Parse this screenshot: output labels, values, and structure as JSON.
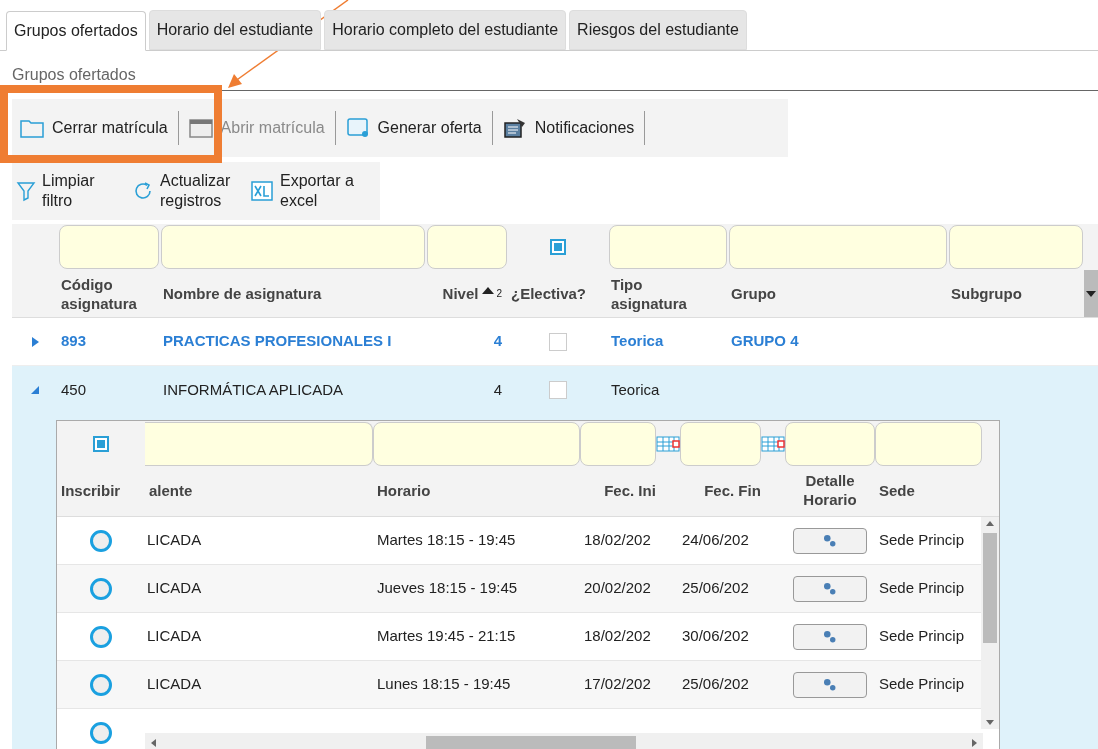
{
  "tabs": [
    {
      "label": "Grupos ofertados",
      "selected": true
    },
    {
      "label": "Horario del estudiante",
      "selected": false
    },
    {
      "label": "Horario completo del estudiante",
      "selected": false
    },
    {
      "label": "Riesgos del estudiante",
      "selected": false
    }
  ],
  "section_title": "Grupos ofertados",
  "toolbar": [
    {
      "kind": "folder",
      "label": "Cerrar matrícula",
      "disabled": false
    },
    {
      "kind": "window",
      "label": "Abrir matrícula",
      "disabled": true
    },
    {
      "kind": "drive",
      "label": "Generar oferta",
      "disabled": false
    },
    {
      "kind": "notify",
      "label": "Notificaciones",
      "disabled": false
    }
  ],
  "actions": [
    {
      "kind": "filter",
      "label": "Limpiar filtro"
    },
    {
      "kind": "refresh",
      "label": "Actualizar registros"
    },
    {
      "kind": "excel",
      "label": "Exportar a excel"
    }
  ],
  "grid": {
    "electiva_filter_indeterminate": true,
    "columns": [
      {
        "label": "Código asignatura"
      },
      {
        "label": "Nombre de asignatura"
      },
      {
        "label": "Nivel",
        "sort": "2"
      },
      {
        "label": "¿Electiva?"
      },
      {
        "label": "Tipo asignatura"
      },
      {
        "label": "Grupo"
      },
      {
        "label": "Subgrupo"
      }
    ],
    "rows": [
      {
        "codigo": "893",
        "nombre": "PRACTICAS PROFESIONALES I",
        "nivel": "4",
        "electiva": false,
        "tipo": "Teorica",
        "grupo": "GRUPO 4",
        "expanded": false,
        "emphasized": true
      },
      {
        "codigo": "450",
        "nombre": "INFORMÁTICA APLICADA",
        "nivel": "4",
        "electiva": false,
        "tipo": "Teorica",
        "expanded": true,
        "emphasized": false
      }
    ]
  },
  "subgrid": {
    "inscribir_filter_indeterminate": true,
    "columns": [
      {
        "label": "Inscribir"
      },
      {
        "label": "alente"
      },
      {
        "label": "Horario"
      },
      {
        "label": "Fec. Ini"
      },
      {
        "label": "Fec. Fin"
      },
      {
        "label": "Detalle Horario"
      },
      {
        "label": "Sede"
      }
    ],
    "rows": [
      {
        "selected": false,
        "equivalente": "LICADA",
        "horario": "Martes 18:15 - 19:45",
        "fec_ini": "18/02/202",
        "fec_fin": "24/06/202",
        "sede": "Sede Princip"
      },
      {
        "selected": false,
        "equivalente": "LICADA",
        "horario": "Jueves 18:15 - 19:45",
        "fec_ini": "20/02/202",
        "fec_fin": "25/06/202",
        "sede": "Sede Princip"
      },
      {
        "selected": false,
        "equivalente": "LICADA",
        "horario": "Martes 19:45 - 21:15",
        "fec_ini": "18/02/202",
        "fec_fin": "30/06/202",
        "sede": "Sede Princip"
      },
      {
        "selected": false,
        "equivalente": "LICADA",
        "horario": "Lunes 18:15 - 19:45",
        "fec_ini": "17/02/202",
        "fec_fin": "25/06/202",
        "sede": "Sede Princip"
      },
      {
        "selected": false
      }
    ]
  }
}
